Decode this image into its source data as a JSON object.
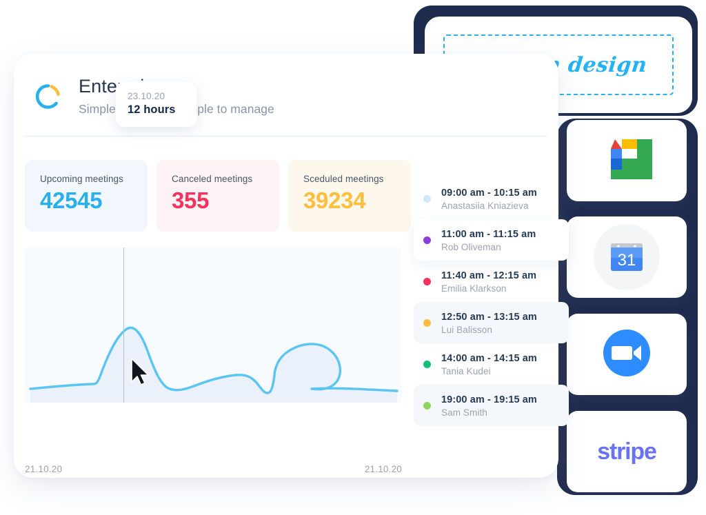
{
  "brand": {
    "logo_icon": "ring-logo-icon",
    "title": "Enterprise",
    "subtitle": "Simple to set up - Simple to manage",
    "accent_blue": "#29b0ec",
    "accent_yellow": "#fcbe3c"
  },
  "stats": [
    {
      "label": "Upcoming meetings",
      "value": "42545",
      "color": "#29b0ec",
      "bg": "#f2f7fd"
    },
    {
      "label": "Canceled meetings",
      "value": "355",
      "color": "#f6315e",
      "bg": "#fdf2f4"
    },
    {
      "label": "Sceduled meetings",
      "value": "39234",
      "color": "#fcbe3c",
      "bg": "#fef7ec"
    }
  ],
  "chart_data": {
    "type": "area",
    "title": "",
    "xlabel": "",
    "ylabel": "",
    "line_color": "#5bc5f2",
    "fill_color": "#eef4fc",
    "grid": false,
    "legend": "none",
    "x_tick_labels": [
      "21.10.20",
      "21.10.20"
    ],
    "tooltip": {
      "date": "23.10.20",
      "value": "12 hours",
      "x_index": 8
    },
    "cursor_icon": "mouse-pointer-icon",
    "x": [
      0,
      1,
      2,
      3,
      4,
      5,
      6,
      7,
      8,
      9,
      10,
      11,
      12,
      13,
      14,
      15,
      16,
      17,
      18,
      19,
      20,
      21,
      22,
      23,
      24
    ],
    "values": [
      1.0,
      1.2,
      1.4,
      1.5,
      1.6,
      8.0,
      11.2,
      11.9,
      12.0,
      10.6,
      6.2,
      3.0,
      2.1,
      2.2,
      2.6,
      3.2,
      3.6,
      3.5,
      2.4,
      1.2,
      6.3,
      7.4,
      7.5,
      6.0,
      2.4
    ],
    "ylim": [
      0,
      13
    ]
  },
  "meetings": {
    "items": [
      {
        "time": "09:00 am - 10:15 am",
        "name": "Anastasiia Kniazieva",
        "dot": "#cfe9fb",
        "style": "plain"
      },
      {
        "time": "11:00 am - 11:15 am",
        "name": "Rob Oliveman",
        "dot": "#8b3ee0",
        "style": "card"
      },
      {
        "time": "11:40 am - 12:15 am",
        "name": "Emilia Klarkson",
        "dot": "#f6315e",
        "style": "plain"
      },
      {
        "time": "12:50 am - 13:15 am",
        "name": "Lui Balisson",
        "dot": "#fcbe3c",
        "style": "tint"
      },
      {
        "time": "14:00 am - 14:15 am",
        "name": "Tania Kudei",
        "dot": "#12c07a",
        "style": "plain"
      },
      {
        "time": "19:00 am - 19:15 am",
        "name": "Sam Smith",
        "dot": "#8ed45e",
        "style": "tint"
      }
    ]
  },
  "custom_design": {
    "label": "Custom design",
    "text_color": "#24b2f0",
    "border_color": "#29b0ec",
    "shadow_color": "#1f2b4d"
  },
  "integrations": {
    "shadow_color": "#1f2b4d",
    "items": [
      {
        "name": "google-meet-logo-icon",
        "label": ""
      },
      {
        "name": "google-calendar-logo-icon",
        "label": "31"
      },
      {
        "name": "zoom-logo-icon",
        "label": ""
      },
      {
        "name": "stripe-logo-icon",
        "label": "stripe"
      }
    ]
  }
}
